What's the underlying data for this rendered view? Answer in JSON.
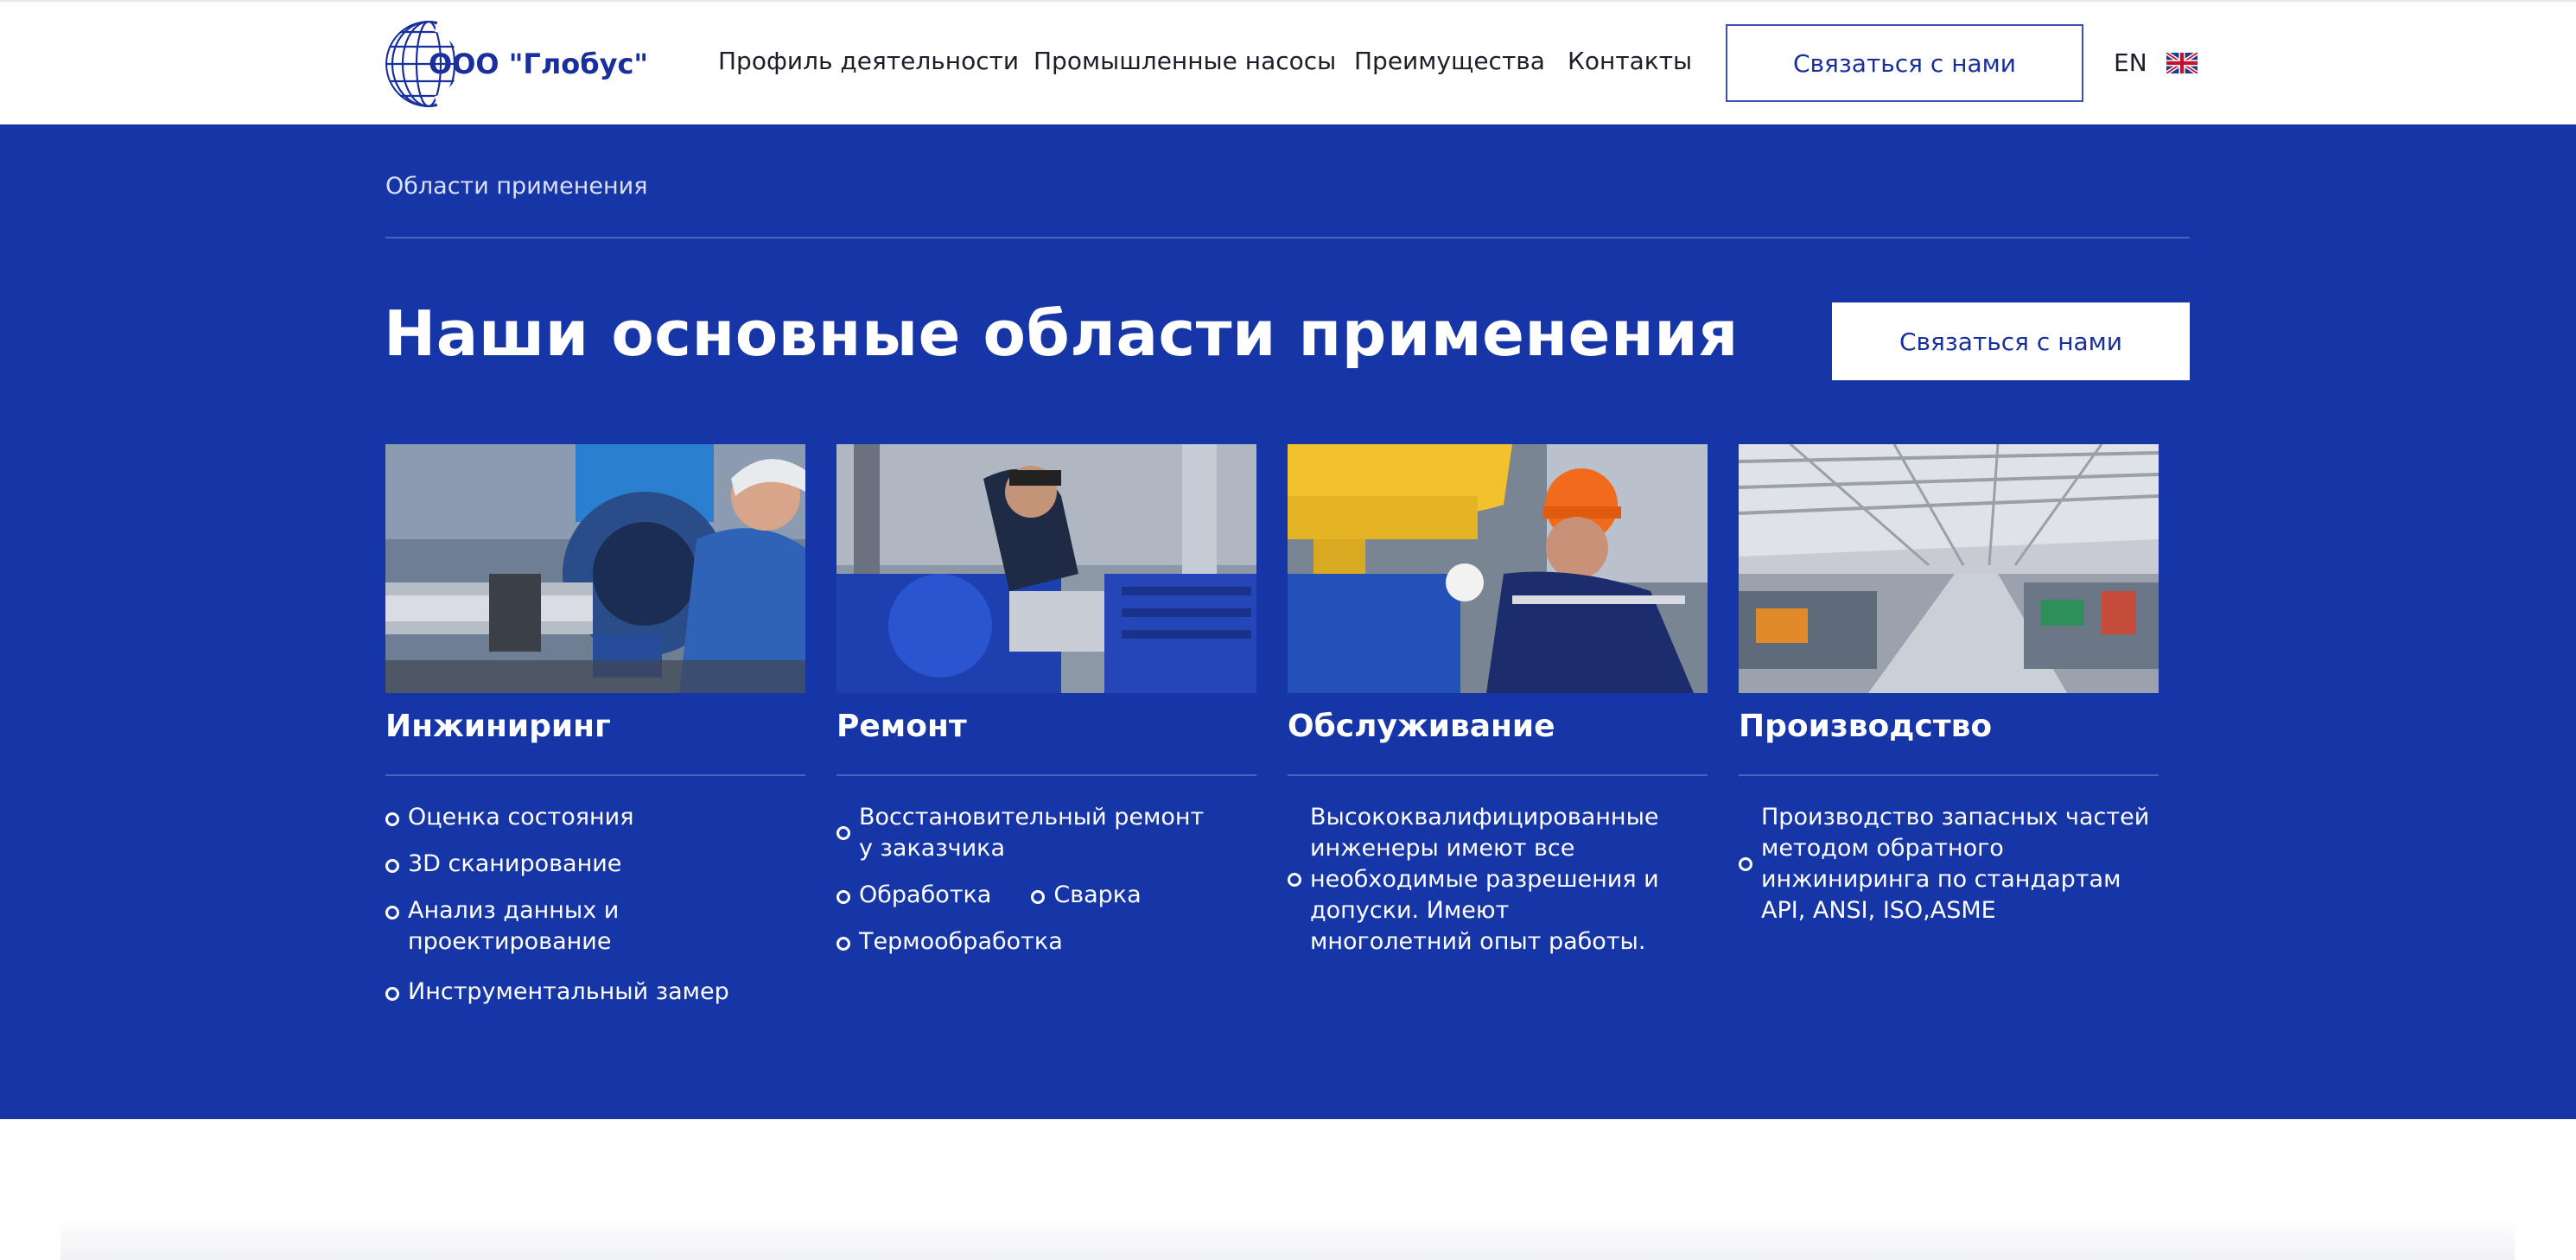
{
  "brand": {
    "name": "ООО \"Глобус\"",
    "color": "#1a2f9e"
  },
  "nav": {
    "items": [
      {
        "label": "Профиль деятельности"
      },
      {
        "label": "Промышленные насосы"
      },
      {
        "label": "Преимущества"
      },
      {
        "label": "Контакты"
      }
    ],
    "contact_button": "Связаться с нами",
    "language": "EN",
    "language_icon": "uk-flag-icon"
  },
  "hero": {
    "background": "#1635a7",
    "breadcrumb": "Области применения",
    "title": "Наши основные области применения",
    "contact_button": "Связаться с нами"
  },
  "cards": [
    {
      "title": "Инжиниринг",
      "image": "engineer-laser-alignment-pump",
      "bullets": [
        "Оценка состояния",
        "3D сканирование",
        "Анализ данных и проектирование",
        "Инструментальный замер"
      ]
    },
    {
      "title": "Ремонт",
      "image": "technician-repairing-blue-pump",
      "bullets": [
        "Восстановительный ремонт у заказчика",
        "Обработка",
        "Сварка",
        "Термообработка"
      ]
    },
    {
      "title": "Обслуживание",
      "image": "worker-orange-helmet-yellow-pump",
      "bullets": [
        "Высококвалифицированные инженеры имеют все необходимые разрешения и допуски. Имеют многолетний опыт работы."
      ]
    },
    {
      "title": "Производство",
      "image": "factory-production-hall",
      "bullets": [
        "Производство запасных частей методом обратного инжиниринга по стандартам API, ANSI, ISO,ASME"
      ]
    }
  ]
}
